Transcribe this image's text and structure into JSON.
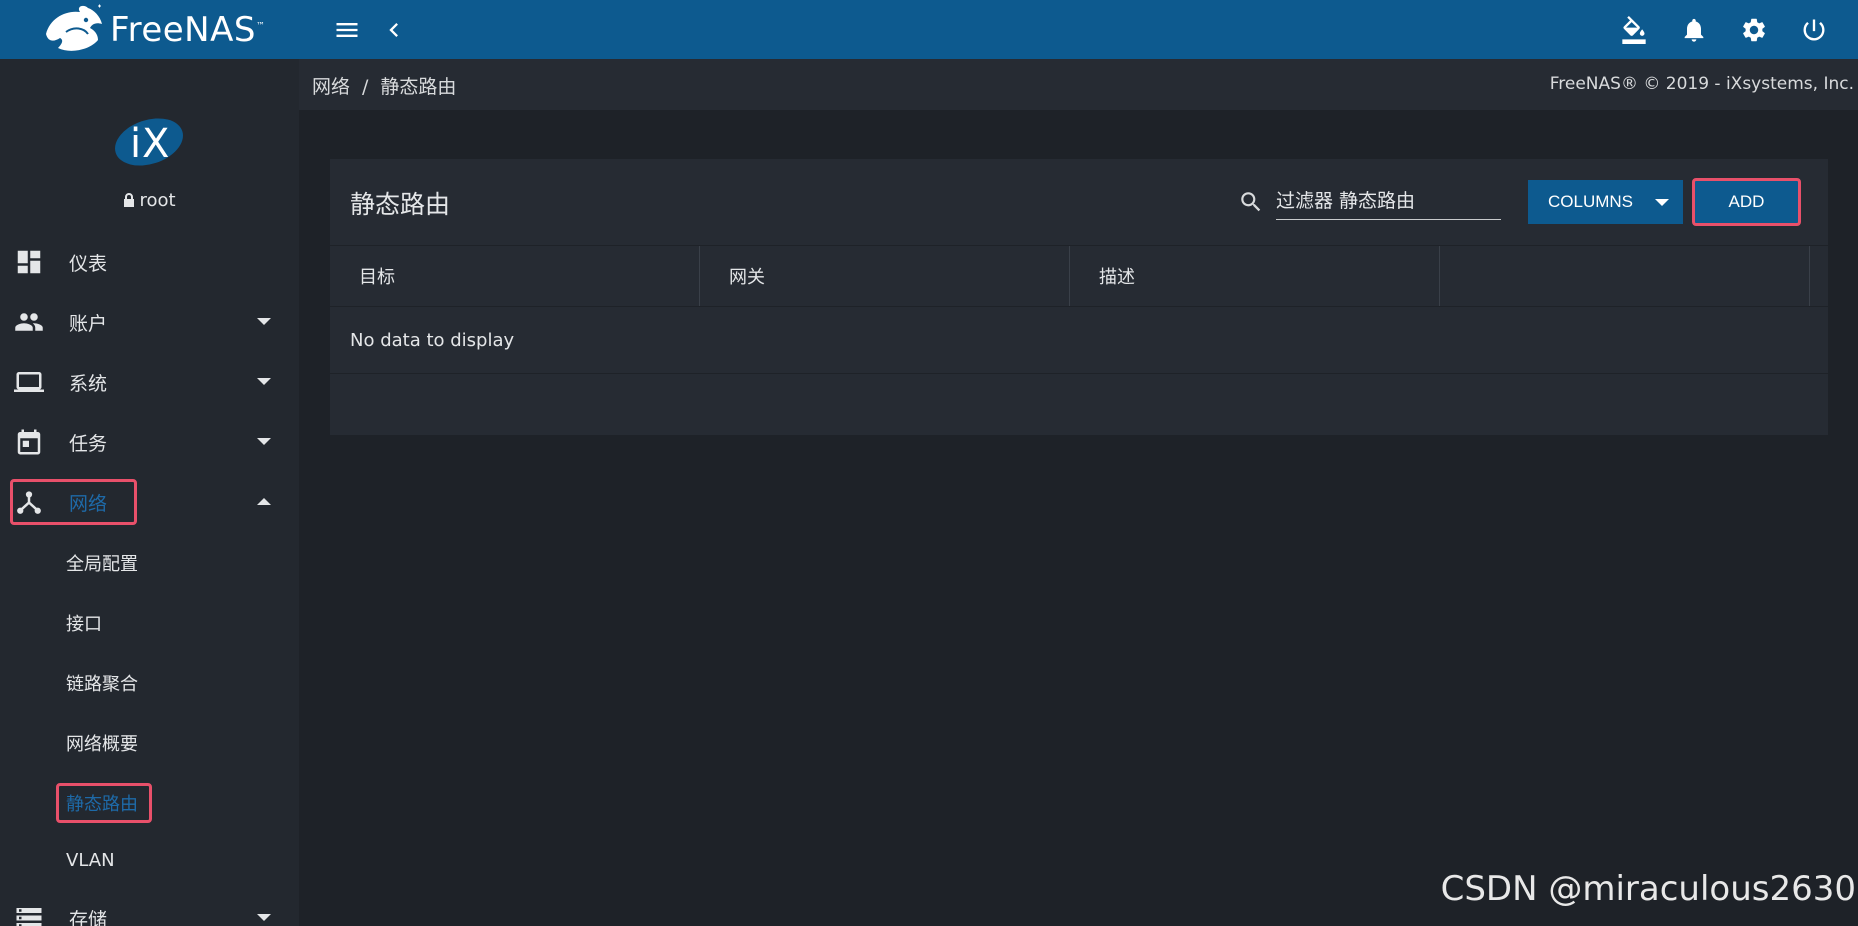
{
  "topbar": {
    "brand": "FreeNAS",
    "brand_tm": "™"
  },
  "sidebar": {
    "username": "root",
    "items": [
      {
        "label": "仪表",
        "icon": "dashboard-icon"
      },
      {
        "label": "账户",
        "icon": "accounts-icon",
        "expandable": true
      },
      {
        "label": "系统",
        "icon": "laptop-icon",
        "expandable": true
      },
      {
        "label": "任务",
        "icon": "calendar-icon",
        "expandable": true
      },
      {
        "label": "网络",
        "icon": "network-icon",
        "expanded": true,
        "active": true
      },
      {
        "label": "存储",
        "icon": "storage-icon",
        "expandable": true
      }
    ],
    "network_sub": [
      {
        "label": "全局配置"
      },
      {
        "label": "接口"
      },
      {
        "label": "链路聚合"
      },
      {
        "label": "网络概要"
      },
      {
        "label": "静态路由",
        "active": true
      },
      {
        "label": "VLAN"
      }
    ]
  },
  "breadcrumb": {
    "parent": "网络",
    "separator": "/",
    "current": "静态路由"
  },
  "copyright": "FreeNAS® © 2019 - iXsystems, Inc.",
  "card": {
    "title": "静态路由",
    "search_placeholder": "过滤器 静态路由",
    "columns_label": "COLUMNS",
    "add_label": "ADD",
    "columns": [
      "目标",
      "网关",
      "描述",
      ""
    ],
    "empty_text": "No data to display"
  },
  "watermark": "CSDN @miraculous2630",
  "colors": {
    "topbar": "#0d5a8f",
    "sidebar": "#23282f",
    "background": "#1e2228",
    "card": "#262b33",
    "accent": "#1e6aa8",
    "highlight": "#e8506a"
  }
}
